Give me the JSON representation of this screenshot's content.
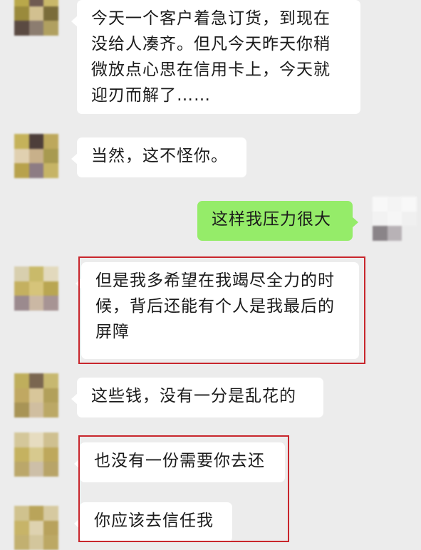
{
  "messages": [
    {
      "side": "left",
      "text": "今天一个客户着急订货，到现在没给人凑齐。但凡今天昨天你稍微放点心思在信用卡上，今天就迎刃而解了……"
    },
    {
      "side": "left",
      "text": "当然，这不怪你。"
    },
    {
      "side": "right",
      "text": "这样我压力很大"
    },
    {
      "side": "left",
      "text": "但是我多希望在我竭尽全力的时候，背后还能有个人是我最后的屏障"
    },
    {
      "side": "left",
      "text": "这些钱，没有一分是乱花的"
    },
    {
      "side": "left",
      "text": "也没有一份需要你去还"
    },
    {
      "side": "left",
      "text": "你应该去信任我"
    }
  ],
  "colors": {
    "background": "#ececec",
    "left_bubble": "#ffffff",
    "right_bubble": "#95ec69",
    "highlight_border": "#c8262c"
  }
}
